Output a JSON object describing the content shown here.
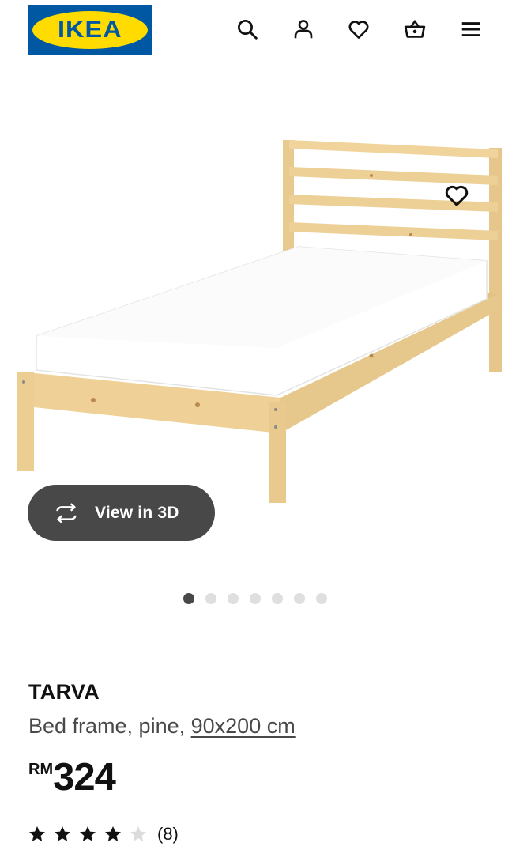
{
  "header": {
    "logo_text": "IKEA",
    "icons": [
      "search-icon",
      "user-icon",
      "heart-icon",
      "basket-icon",
      "menu-icon"
    ]
  },
  "gallery": {
    "button_label": "View in 3D",
    "slide_count": 7,
    "active_slide": 1
  },
  "product": {
    "name": "TARVA",
    "description": "Bed frame, pine, ",
    "size": "90x200 cm",
    "currency": "RM",
    "price": "324",
    "rating": 4,
    "rating_max": 5,
    "review_count": "(8)"
  },
  "colors": {
    "brand_blue": "#0058a3",
    "brand_yellow": "#ffdb00",
    "button_dark": "#484848"
  }
}
